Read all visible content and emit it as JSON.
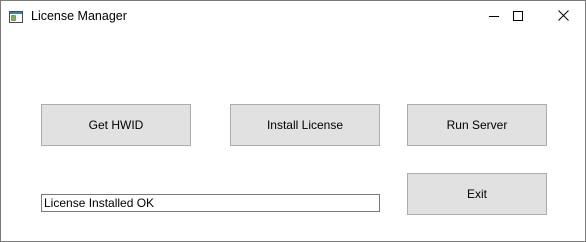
{
  "window": {
    "title": "License Manager",
    "icon": "window-app-icon",
    "controls": {
      "minimize_icon": "minimize-icon",
      "maximize_icon": "maximize-icon",
      "close_icon": "close-icon"
    }
  },
  "buttons": {
    "get_hwid": "Get HWID",
    "install_license": "Install License",
    "run_server": "Run Server",
    "exit": "Exit"
  },
  "status": {
    "value": "License Installed OK"
  },
  "colors": {
    "button_face": "#e1e1e1",
    "button_border": "#adadad",
    "window_bg": "#ffffff"
  }
}
